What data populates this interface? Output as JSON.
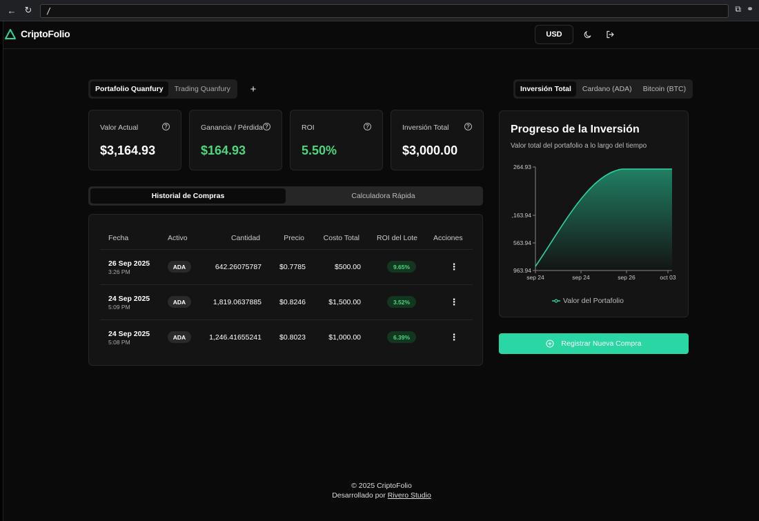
{
  "browser": {
    "url": "/"
  },
  "app": {
    "name": "CriptoFolio",
    "currency": "USD",
    "accent": "#2ad6a4"
  },
  "portfolio_tabs": [
    {
      "label": "Portafolio Quanfury",
      "active": true
    },
    {
      "label": "Trading Quanfury",
      "active": false
    }
  ],
  "add_label": "+",
  "stats": [
    {
      "label": "Valor Actual",
      "value": "$3,164.93",
      "positive": false
    },
    {
      "label": "Ganancia / Pérdida",
      "value": "$164.93",
      "positive": true
    },
    {
      "label": "ROI",
      "value": "5.50%",
      "positive": true
    },
    {
      "label": "Inversión Total",
      "value": "$3,000.00",
      "positive": false
    }
  ],
  "history_tabs": [
    {
      "label": "Historial de Compras",
      "active": true
    },
    {
      "label": "Calculadora Rápida",
      "active": false
    }
  ],
  "table": {
    "headers": [
      "Fecha",
      "Activo",
      "Cantidad",
      "Precio",
      "Costo Total",
      "ROI del Lote",
      "Acciones"
    ],
    "rows": [
      {
        "date": "26 Sep 2025",
        "time": "3:26 PM",
        "asset": "ADA",
        "quantity": "642.26075787",
        "price": "$0.7785",
        "cost": "$500.00",
        "roi": "9.65%"
      },
      {
        "date": "24 Sep 2025",
        "time": "5:09 PM",
        "asset": "ADA",
        "quantity": "1,819.0637885",
        "price": "$0.8246",
        "cost": "$1,500.00",
        "roi": "3.52%"
      },
      {
        "date": "24 Sep 2025",
        "time": "5:08 PM",
        "asset": "ADA",
        "quantity": "1,246.41655241",
        "price": "$0.8023",
        "cost": "$1,000.00",
        "roi": "6.39%"
      }
    ]
  },
  "investment_tabs": [
    {
      "label": "Inversión Total",
      "active": true
    },
    {
      "label": "Cardano (ADA)",
      "active": false
    },
    {
      "label": "Bitcoin (BTC)",
      "active": false
    }
  ],
  "chart_panel": {
    "title": "Progreso de la Inversión",
    "subtitle": "Valor total del portafolio a lo largo del tiempo"
  },
  "chart_data": {
    "type": "area",
    "title": "Progreso de la Inversión",
    "ytick_labels": [
      "264.93",
      ",163.94",
      "563.94",
      "963.94"
    ],
    "xtick_labels": [
      "sep 24",
      "sep 24",
      "sep 26",
      "oct 03"
    ],
    "series": [
      {
        "name": "Valor del Portafolio",
        "color": "#2ad6a4",
        "shape": "smooth rise from bottom-left to a plateau at the top value"
      }
    ],
    "grid": false,
    "legend": "bottom"
  },
  "register_button": "Registrar Nueva Compra",
  "footer": {
    "copyright": "© 2025 CriptoFolio",
    "developed_by": "Desarrollado por",
    "studio": "Rivero Studio"
  }
}
